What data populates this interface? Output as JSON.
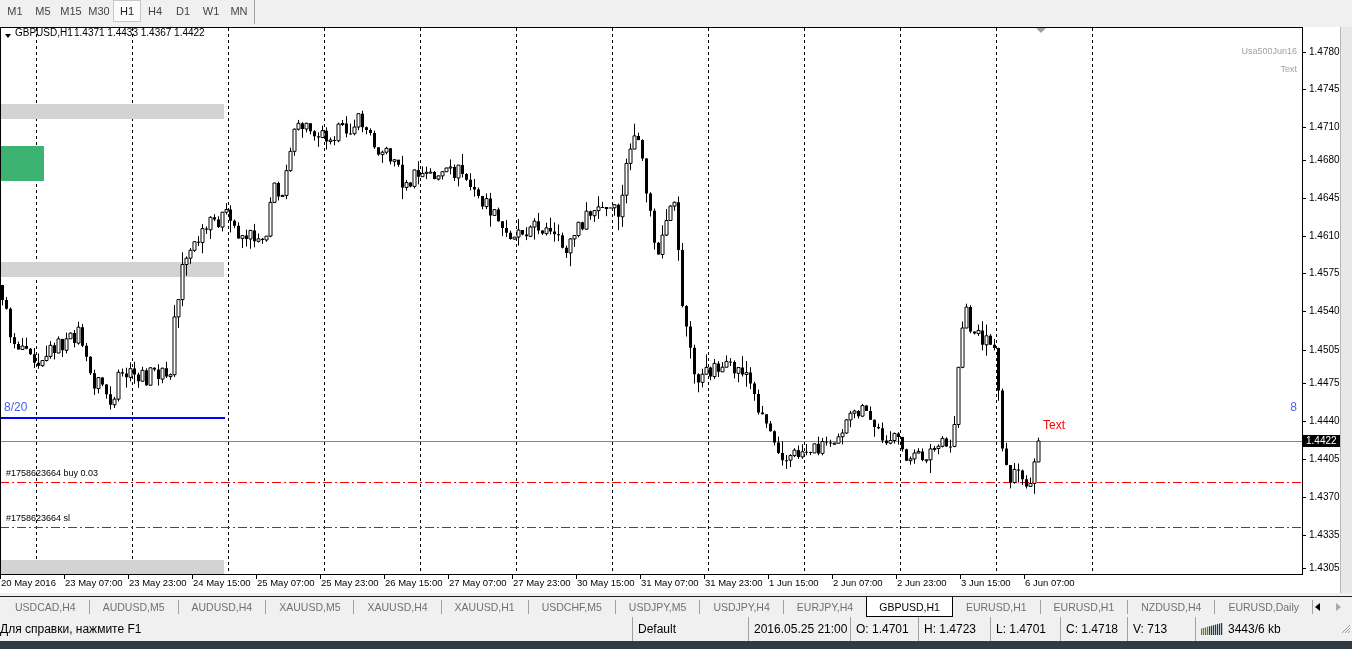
{
  "timeframes": [
    {
      "label": "M1",
      "selected": false
    },
    {
      "label": "M5",
      "selected": false
    },
    {
      "label": "M15",
      "selected": false
    },
    {
      "label": "M30",
      "selected": false
    },
    {
      "label": "H1",
      "selected": true
    },
    {
      "label": "H4",
      "selected": false
    },
    {
      "label": "D1",
      "selected": false
    },
    {
      "label": "W1",
      "selected": false
    },
    {
      "label": "MN",
      "selected": false
    }
  ],
  "chart": {
    "symbol": "GBPUSD,H1",
    "ohlc": "1.4371 1.4433 1.4367 1.4422",
    "price_labels": [
      "1.4780",
      "1.4745",
      "1.4710",
      "1.4680",
      "1.4645",
      "1.4610",
      "1.4575",
      "1.4540",
      "1.4505",
      "1.4475",
      "1.4440",
      "1.4405",
      "1.4370",
      "1.4335",
      "1.4305"
    ],
    "current_price": "1.4422",
    "time_labels": [
      "20 May 2016",
      "23 May 07:00",
      "23 May 23:00",
      "24 May 15:00",
      "25 May 07:00",
      "25 May 23:00",
      "26 May 15:00",
      "27 May 07:00",
      "27 May 23:00",
      "30 May 15:00",
      "31 May 07:00",
      "31 May 23:00",
      "1 Jun 15:00",
      "2 Jun 07:00",
      "2 Jun 23:00",
      "3 Jun 15:00",
      "6 Jun 07:00"
    ],
    "level_line": {
      "left_label": "8/20",
      "right_label": "8"
    },
    "order_lines": [
      {
        "label": "#1758623664 buy 0.03",
        "kind": "entry"
      },
      {
        "label": "#1758623664 sl",
        "kind": "stop_loss"
      }
    ],
    "chart_text": "Text",
    "corner_labels": [
      "Usa500Jun16",
      "Text"
    ]
  },
  "tabs": [
    {
      "label": "USDCAD,H4",
      "selected": false
    },
    {
      "label": "AUDUSD,M5",
      "selected": false
    },
    {
      "label": "AUDUSD,H4",
      "selected": false
    },
    {
      "label": "XAUUSD,M5",
      "selected": false
    },
    {
      "label": "XAUUSD,H4",
      "selected": false
    },
    {
      "label": "XAUUSD,H1",
      "selected": false
    },
    {
      "label": "USDCHF,M5",
      "selected": false
    },
    {
      "label": "USDJPY,M5",
      "selected": false
    },
    {
      "label": "USDJPY,H4",
      "selected": false
    },
    {
      "label": "EURJPY,H4",
      "selected": false
    },
    {
      "label": "GBPUSD,H1",
      "selected": true
    },
    {
      "label": "EURUSD,H1",
      "selected": false
    },
    {
      "label": "EURUSD,H1",
      "selected": false
    },
    {
      "label": "NZDUSD,H4",
      "selected": false
    },
    {
      "label": "EURUSD,Daily",
      "selected": false
    }
  ],
  "tab_scroll": [
    {
      "kind": "left",
      "disabled": false
    },
    {
      "kind": "right",
      "disabled": true
    }
  ],
  "status_bar": {
    "help": "Для справки, нажмите F1",
    "profile": "Default",
    "time": "2016.05.25 21:00",
    "open": "O: 1.4701",
    "high": "H: 1.4723",
    "low": "L: 1.4701",
    "close": "C: 1.4718",
    "volume": "V: 713",
    "traffic": "3443/6 kb"
  }
}
